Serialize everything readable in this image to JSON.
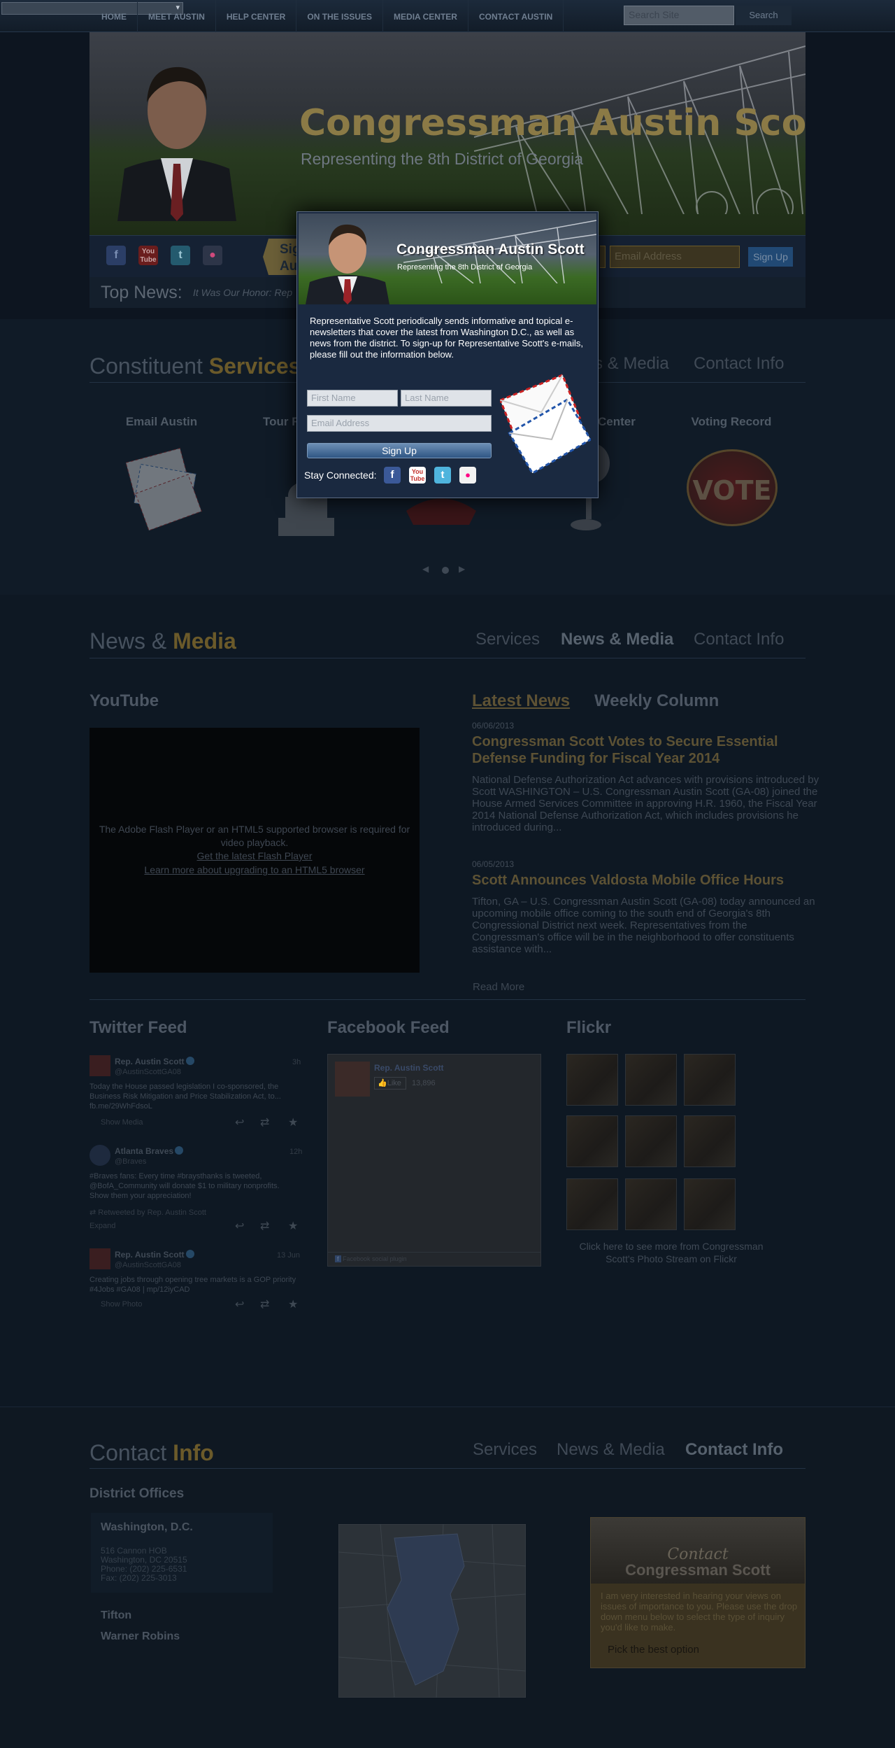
{
  "topbar": {
    "language_select": "",
    "search_placeholder": "Search Site",
    "search_button": "Search"
  },
  "nav": [
    "HOME",
    "MEET AUSTIN",
    "HELP CENTER",
    "ON THE ISSUES",
    "MEDIA CENTER",
    "CONTACT AUSTIN"
  ],
  "header": {
    "title": "Congressman Austin Scott",
    "subtitle": "Representing the 8th District of Georgia"
  },
  "signup_bar": {
    "text_line1": "Sign",
    "text_line2": "Aust",
    "email_placeholder": "Email Address",
    "button": "Sign Up"
  },
  "top_news": {
    "label": "Top News:",
    "text": "It Was Our Honor: Rep"
  },
  "constituent": {
    "title_plain": "Constituent",
    "title_bold": "Services",
    "nav": [
      "s & Media",
      "Contact Info"
    ],
    "items": [
      {
        "label": "Email Austin"
      },
      {
        "label": "Tour R"
      },
      {
        "label": ""
      },
      {
        "label": "Center"
      },
      {
        "label": "Voting Record"
      }
    ],
    "vote_badge": "VOTE"
  },
  "news_media": {
    "title_plain": "News &",
    "title_bold": "Media",
    "nav": [
      "Services",
      "News & Media",
      "Contact Info"
    ],
    "youtube_heading": "YouTube",
    "flash_msg": "The Adobe Flash Player or an HTML5 supported browser is required for video playback.",
    "flash_link1": "Get the latest Flash Player",
    "flash_link2": "Learn more about upgrading to an HTML5 browser",
    "tab_latest": "Latest News",
    "tab_weekly": "Weekly Column",
    "articles": [
      {
        "date": "06/06/2013",
        "headline": "Congressman Scott Votes to Secure Essential Defense Funding for Fiscal Year 2014",
        "excerpt": "National Defense Authorization Act advances with provisions introduced by Scott WASHINGTON – U.S. Congressman Austin Scott (GA-08) joined the House Armed Services Committee in approving H.R. 1960, the Fiscal Year 2014 National Defense Authorization Act, which includes provisions he introduced during..."
      },
      {
        "date": "06/05/2013",
        "headline": "Scott Announces Valdosta Mobile Office Hours",
        "excerpt": "Tifton, GA – U.S. Congressman Austin Scott (GA-08) today announced an upcoming mobile office coming to the south end of Georgia's 8th Congressional District next week. Representatives from the Congressman's office will be in the neighborhood to offer constituents assistance with..."
      }
    ],
    "read_more": "Read More"
  },
  "feeds": {
    "twitter_heading": "Twitter Feed",
    "facebook_heading": "Facebook Feed",
    "flickr_heading": "Flickr",
    "tweets": [
      {
        "name": "Rep. Austin Scott",
        "handle": "@AustinScottGA08",
        "time": "3h",
        "text": "Today the House passed legislation I co-sponsored, the Business Risk Mitigation and Price Stabilization Act, to... fb.me/29WhFdsoL",
        "footer": "Show Media",
        "retweet": ""
      },
      {
        "name": "Atlanta Braves",
        "handle": "@Braves",
        "time": "12h",
        "text": "#Braves fans: Every time #braysthanks is tweeted, @BofA_Community will donate $1 to military nonprofits. Show them your appreciation!",
        "footer": "Expand",
        "retweet": "Retweeted by Rep. Austin Scott"
      },
      {
        "name": "Rep. Austin Scott",
        "handle": "@AustinScottGA08",
        "time": "13 Jun",
        "text": "Creating jobs through opening tree markets is a GOP priority #4Jobs #GA08 | mp/12iyCAD",
        "footer": "Show Photo",
        "retweet": ""
      }
    ],
    "facebook": {
      "page_name": "Rep. Austin Scott",
      "like": "Like",
      "count": "13,896",
      "footer": "Facebook social plugin"
    },
    "flickr_caption": "Click here to see more from Congressman Scott's Photo Stream on Flickr"
  },
  "contact": {
    "title_plain": "Contact",
    "title_bold": "Info",
    "nav": [
      "Services",
      "News & Media",
      "Contact Info"
    ],
    "offices_heading": "District Offices",
    "offices": [
      {
        "name": "Washington, D.C.",
        "lines": [
          "516 Cannon HOB",
          "Washington, DC 20515",
          "Phone: (202) 225-6531",
          "Fax: (202) 225-3013"
        ]
      },
      {
        "name": "Tifton",
        "lines": []
      },
      {
        "name": "Warner Robins",
        "lines": []
      }
    ],
    "contact_card_script": "Contact",
    "contact_card_title": "Congressman Scott",
    "contact_card_text": "I am very interested in hearing your views on issues of importance to you. Please use the drop down menu below to select the type of inquiry you'd like to make.",
    "contact_select": "Pick the best option"
  },
  "modal": {
    "title": "Congressman Austin Scott",
    "subtitle": "Representing the 8th District of Georgia",
    "description": "Representative Scott periodically sends informative and topical e-newsletters that cover the latest from Washington D.C., as well as news from the district. To sign-up for Representative Scott's e-mails, please fill out the information below.",
    "first_name": "First Name",
    "last_name": "Last Name",
    "email": "Email Address",
    "button": "Sign Up",
    "stay_connected": "Stay Connected:"
  },
  "social_icons": [
    "facebook-icon",
    "youtube-icon",
    "twitter-icon",
    "flickr-icon"
  ],
  "colors": {
    "gold": "#6b5a2a",
    "dark_bg": "#0d1520",
    "modal_bg": "#1a2940",
    "signup_blue": "#2f5684"
  }
}
